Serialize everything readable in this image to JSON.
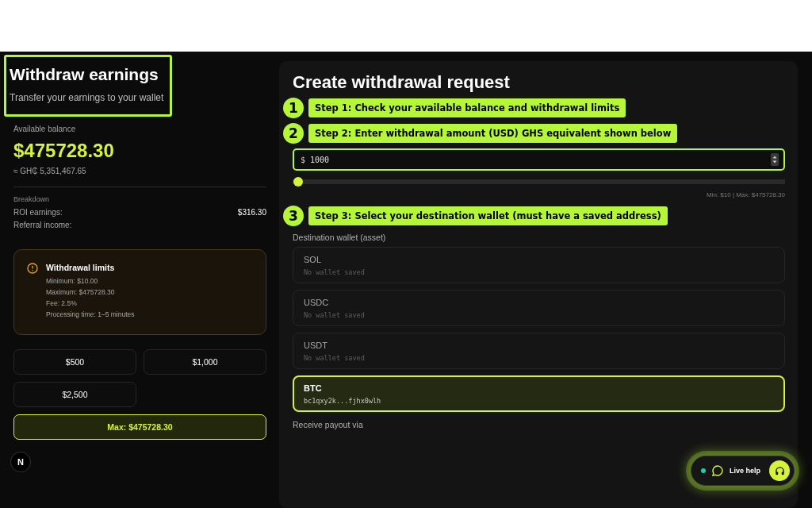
{
  "header": {
    "title": "Withdraw earnings",
    "subtitle": "Transfer your earnings to your wallet"
  },
  "balance": {
    "label": "Available balance",
    "amount": "$475728.30",
    "converted": "≈ GH₵ 5,351,467.65",
    "breakdown_label": "Breakdown",
    "rows": [
      {
        "label": "ROI earnings:",
        "value": "$316.30"
      },
      {
        "label": "Referral income:"
      }
    ]
  },
  "limits": {
    "title": "Withdrawal limits",
    "lines": [
      "Minimum: $10.00",
      "Maximum: $475728.30",
      "Fee: 2.5%",
      "Processing time: 1–5 minutes"
    ]
  },
  "quick_amounts": [
    {
      "label": "$500",
      "kind": "preset"
    },
    {
      "label": "$1,000",
      "kind": "preset"
    },
    {
      "label": "$2,500",
      "kind": "preset"
    },
    {
      "label": "Max: $475728.30",
      "kind": "max"
    }
  ],
  "request": {
    "title": "Create withdrawal request",
    "amount": {
      "prefix": "$",
      "value": "1000"
    },
    "slider": {
      "level": 0.002
    },
    "range_hint": "Min: $10 | Max: $475728.30",
    "wallet_label": "Destination wallet (asset)",
    "wallets": [
      {
        "asset": "SOL",
        "address": "No wallet saved",
        "selected": false
      },
      {
        "asset": "USDC",
        "address": "No wallet saved",
        "selected": false
      },
      {
        "asset": "USDT",
        "address": "No wallet saved",
        "selected": false
      },
      {
        "asset": "BTC",
        "address": "bc1qxy2k...fjhx0wlh",
        "selected": true
      }
    ],
    "payout_label": "Receive payout via"
  },
  "tour_steps": [
    {
      "number": "1",
      "text": "Step 1: Check your available balance and withdrawal limits"
    },
    {
      "number": "2",
      "text": "Step 2: Enter withdrawal amount (USD) GHS equivalent shown below"
    },
    {
      "number": "3",
      "text": "Step 3: Select your destination wallet (must have a saved address)"
    }
  ],
  "live_help": {
    "label": "Live help",
    "online": true
  },
  "dev_badge": {
    "label": "N"
  }
}
